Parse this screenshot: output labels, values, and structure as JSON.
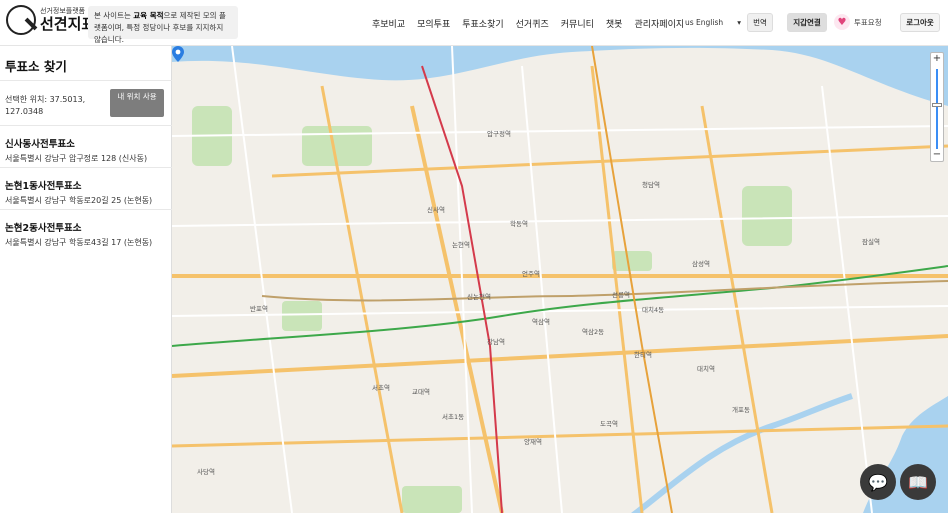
{
  "header": {
    "logo_sub": "선거정보플랫폼",
    "logo_main": "선견지표",
    "notice_pre": "본 사이트는 ",
    "notice_bold": "교육 목적",
    "notice_post": "으로 제작된 모의 플랫폼이며, 특정 정당이나 후보를 지지하지 않습니다.",
    "nav": [
      "후보비교",
      "모의투표",
      "투표소찾기",
      "선거퀴즈",
      "커뮤니티",
      "챗봇",
      "관리자페이지"
    ],
    "language": "us English",
    "translate_label": "번역",
    "wallet_label": "지갑연결",
    "vote_request_label": "투표요청",
    "logout_label": "로그아웃"
  },
  "sidebar": {
    "title": "투표소 찾기",
    "location_label": "선택한 위치: 37.5013, 127.0348",
    "my_location_button": "내 위치 사용",
    "stations": [
      {
        "name": "신사동사전투표소",
        "address": "서울특별시 강남구 압구정로 128 (신사동)"
      },
      {
        "name": "논현1동사전투표소",
        "address": "서울특별시 강남구 학동로20길 25 (논현동)"
      },
      {
        "name": "논현2동사전투표소",
        "address": "서울특별시 강남구 학동로43길 17 (논현동)"
      }
    ]
  },
  "map": {
    "labels": {
      "sinsa": "신사역",
      "nonhyeon": "논현역",
      "gangnam": "강남역",
      "yeoksam": "역삼역",
      "seolleung": "선릉역",
      "samseong": "삼성역",
      "apgujeong": "압구정역",
      "cheongdam": "청담역",
      "sinnonhyeon": "신논현역",
      "hakdong": "학동역",
      "eonju": "언주역",
      "seocho": "서초역",
      "gyodae": "교대역",
      "yangjae": "양재역",
      "dogok": "도곡역",
      "hanti": "한티역",
      "daechi": "대치역",
      "jamsil": "잠실역",
      "banpo": "반포역",
      "sadang": "사당역",
      "yeoksam2": "역삼2동",
      "daechi4": "대치4동",
      "seocho1": "서초1동",
      "gaepo": "개포동"
    },
    "zoom_in": "+",
    "zoom_out": "−"
  },
  "colors": {
    "river": "#a9d2ef",
    "park": "#c9e4b8",
    "road_major": "#f5c26b",
    "road_minor": "#ffffff",
    "rail_green": "#3da84a",
    "rail_red": "#d43a4b",
    "pin": "#2a7de1"
  },
  "icons": {
    "chat_fab": "chat-icon",
    "book_fab": "book-icon"
  }
}
